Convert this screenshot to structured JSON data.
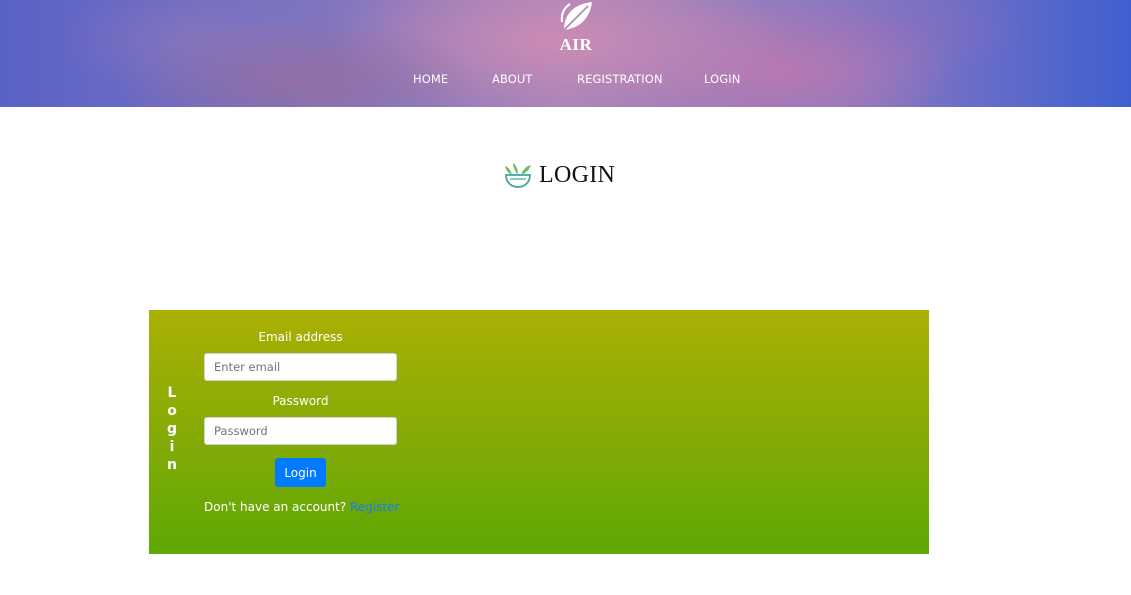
{
  "header": {
    "logo_text": "AIR",
    "logo_icon": "leaf-icon",
    "nav": [
      {
        "label": "HOME"
      },
      {
        "label": "ABOUT"
      },
      {
        "label": "REGISTRATION"
      },
      {
        "label": "LOGIN"
      }
    ]
  },
  "page": {
    "title": "LOGIN",
    "title_icon": "plant-bowl-icon"
  },
  "login_panel": {
    "side_label": [
      "L",
      "o",
      "g",
      "i",
      "n"
    ],
    "email_label": "Email address",
    "email_value": "",
    "email_placeholder": "Enter email",
    "password_label": "Password",
    "password_value": "",
    "password_placeholder": "Password",
    "submit_label": "Login",
    "register_prompt": "Don't have an account?",
    "register_link": "Register"
  },
  "colors": {
    "panel_top": "#aab004",
    "panel_bottom": "#5ea804",
    "button": "#007bff",
    "link": "#1a7cf5"
  }
}
